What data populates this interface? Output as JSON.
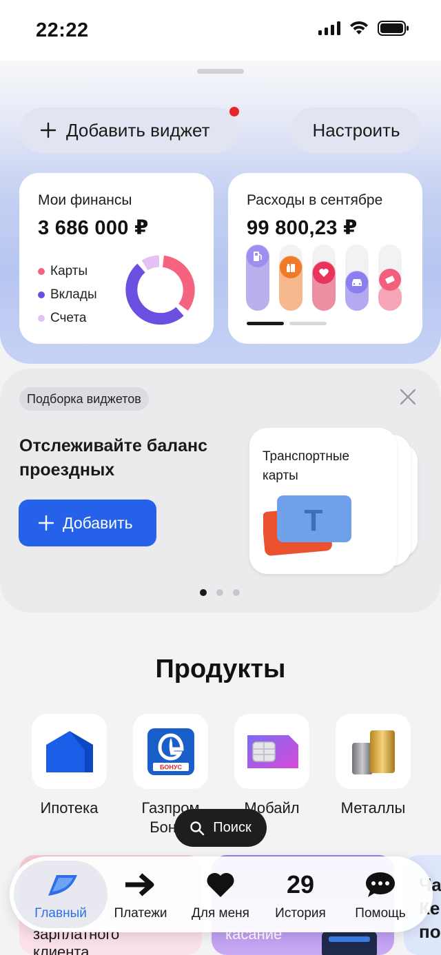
{
  "status_bar": {
    "time": "22:22"
  },
  "widgets": {
    "add_widget_label": "Добавить виджет",
    "customize_label": "Настроить",
    "finances": {
      "title": "Мои финансы",
      "amount": "3 686 000 ₽",
      "legend": [
        {
          "label": "Карты",
          "color": "#f4637f"
        },
        {
          "label": "Вклады",
          "color": "#6a4fe0"
        },
        {
          "label": "Счета",
          "color": "#e3c2f3"
        }
      ]
    },
    "expenses": {
      "title": "Расходы в сентябре",
      "amount": "99 800,23 ₽",
      "categories": [
        {
          "icon": "fuel-icon",
          "color": "#9d8ef0",
          "fill": "#b9b1ee",
          "level": 1.0
        },
        {
          "icon": "groceries-icon",
          "color": "#f07a2a",
          "fill": "#f5b98d",
          "level": 0.83
        },
        {
          "icon": "heart-icon",
          "color": "#e8345a",
          "fill": "#ec8fa3",
          "level": 0.75
        },
        {
          "icon": "car-icon",
          "color": "#8b7ff0",
          "fill": "#b3aaf2",
          "level": 0.6
        },
        {
          "icon": "ticket-icon",
          "color": "#f0607c",
          "fill": "#f6a5b6",
          "level": 0.4
        }
      ]
    }
  },
  "selection": {
    "chip_label": "Подборка виджетов",
    "title_line1": "Отслеживайте баланс",
    "title_line2": "проездных",
    "add_button_label": "Добавить",
    "card_title_line1": "Транспортные",
    "card_title_line2": "карты",
    "card_letter": "Т"
  },
  "products": {
    "title": "Продукты",
    "items": [
      {
        "label": "Ипотека",
        "icon": "house-icon"
      },
      {
        "label": "Газпром Бонус",
        "line1": "Газпром",
        "line2": "Бонус",
        "icon": "gazprom-bonus-icon"
      },
      {
        "label": "Мобайл",
        "icon": "sim-card-icon"
      },
      {
        "label": "Металлы",
        "icon": "gold-bars-icon"
      }
    ],
    "badge_text": "БОНУС"
  },
  "promos": [
    {
      "text_line1": "зарплатного",
      "text_line2": "клиента"
    },
    {
      "text_line1": "касание"
    },
    {
      "text_line1": "Ча",
      "text_line2": "Ке",
      "text_line3": "по"
    }
  ],
  "search": {
    "label": "Поиск"
  },
  "nav": {
    "items": [
      {
        "label": "Главный",
        "icon": "home-logo-icon",
        "active": true
      },
      {
        "label": "Платежи",
        "icon": "arrow-right-icon"
      },
      {
        "label": "Для меня",
        "icon": "heart-icon"
      },
      {
        "label": "История",
        "icon": "calendar-date-icon",
        "date": "29"
      },
      {
        "label": "Помощь",
        "icon": "chat-icon"
      }
    ]
  }
}
